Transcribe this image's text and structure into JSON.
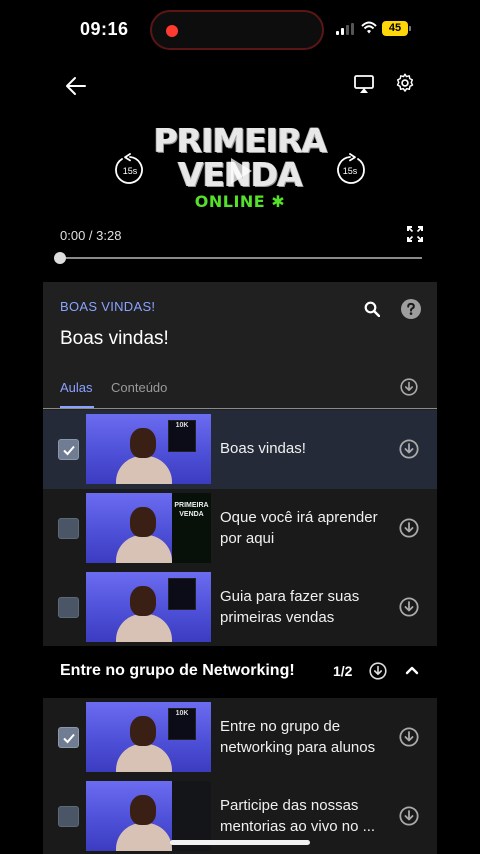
{
  "status_bar": {
    "time": "09:16",
    "battery": "45"
  },
  "player": {
    "logo": {
      "line1": "PRIMEIRA",
      "line2": "VENDA",
      "line3": "ONLINE"
    },
    "skip_back": "15s",
    "skip_forward": "15s",
    "time_readout": "0:00 / 3:28",
    "progress": 0.0
  },
  "course": {
    "section_kicker": "BOAS VINDAS!",
    "current_lesson_title": "Boas vindas!",
    "tabs": [
      {
        "label": "Aulas",
        "active": true
      },
      {
        "label": "Conteúdo",
        "active": false
      }
    ],
    "lessons": [
      {
        "title": "Boas vindas!",
        "completed": true,
        "active": true
      },
      {
        "title": "Oque você irá aprender por aqui",
        "completed": false,
        "active": false
      },
      {
        "title": "Guia para fazer suas primeiras vendas",
        "completed": false,
        "active": false
      }
    ],
    "group": {
      "title": "Entre no grupo de Networking!",
      "count": "1/2",
      "lessons": [
        {
          "title": "Entre no grupo de networking para alunos",
          "completed": true
        },
        {
          "title": "Participe das nossas mentorias ao vivo no ...",
          "completed": false
        }
      ]
    },
    "thumbnail_badge": "10K",
    "thumbnail_logo": "PRIMEIRA VENDA"
  },
  "colors": {
    "accent": "#8aa2ff",
    "active_row": "#252a38",
    "logo_green": "#55e02a"
  }
}
